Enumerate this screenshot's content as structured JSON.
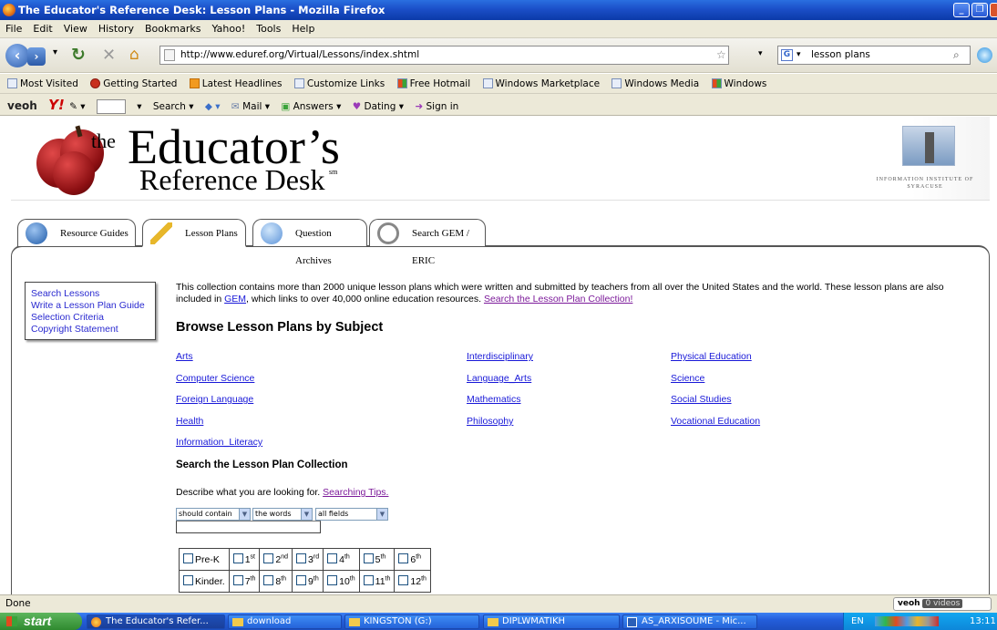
{
  "window": {
    "title": "The Educator's Reference Desk: Lesson Plans - Mozilla Firefox"
  },
  "menu": [
    "File",
    "Edit",
    "View",
    "History",
    "Bookmarks",
    "Yahoo!",
    "Tools",
    "Help"
  ],
  "nav": {
    "url": "http://www.eduref.org/Virtual/Lessons/index.shtml",
    "search_value": "lesson plans"
  },
  "bookmarks": [
    "Most Visited",
    "Getting Started",
    "Latest Headlines",
    "Customize Links",
    "Free Hotmail",
    "Windows Marketplace",
    "Windows Media",
    "Windows"
  ],
  "veoh_toolbar": {
    "logo": "veoh",
    "search": "Search",
    "mail": "Mail",
    "answers": "Answers",
    "dating": "Dating",
    "signin": "Sign in"
  },
  "header": {
    "the": "the",
    "title": "Educator’s",
    "subtitle": "Reference Desk",
    "sm": "sm",
    "institute": "INFORMATION INSTITUTE OF SYRACUSE"
  },
  "tabs": [
    "Resource Guides",
    "Lesson Plans",
    "Question Archives",
    "Search GEM / ERIC"
  ],
  "sidebar": [
    "Search Lessons",
    "Write a Lesson Plan Guide",
    "Selection Criteria",
    "Copyright Statement"
  ],
  "intro": {
    "text1": "This collection contains more than 2000 unique lesson plans which were written and submitted by teachers from all over the United States and the world. These lesson plans are also included in ",
    "gem": "GEM",
    "text2": ", which links to over 40,000 online education resources. ",
    "search_link": "Search the Lesson Plan Collection!"
  },
  "browse": {
    "heading": "Browse Lesson Plans by Subject",
    "col1": [
      "Arts",
      "Computer Science",
      "Foreign Language",
      "Health",
      "Information_Literacy"
    ],
    "col2": [
      "Interdisciplinary",
      "Language_Arts",
      "Mathematics",
      "Philosophy"
    ],
    "col3": [
      "Physical Education",
      "Science",
      "Social Studies",
      "Vocational Education"
    ]
  },
  "search": {
    "heading": "Search the Lesson Plan Collection",
    "describe": "Describe what you are looking for. ",
    "tips": "Searching Tips.",
    "sel1": "should contain",
    "sel2": "the words",
    "sel3": "all fields"
  },
  "grades": {
    "row1": [
      {
        "b": "Pre-K",
        "s": ""
      },
      {
        "b": "1",
        "s": "st"
      },
      {
        "b": "2",
        "s": "nd"
      },
      {
        "b": "3",
        "s": "rd"
      },
      {
        "b": "4",
        "s": "th"
      },
      {
        "b": "5",
        "s": "th"
      },
      {
        "b": "6",
        "s": "th"
      }
    ],
    "row2": [
      {
        "b": "Kinder.",
        "s": ""
      },
      {
        "b": "7",
        "s": "th"
      },
      {
        "b": "8",
        "s": "th"
      },
      {
        "b": "9",
        "s": "th"
      },
      {
        "b": "10",
        "s": "th"
      },
      {
        "b": "11",
        "s": "th"
      },
      {
        "b": "12",
        "s": "th"
      }
    ]
  },
  "status": {
    "text": "Done",
    "veoh": "veoh",
    "videos": "0 videos"
  },
  "taskbar": {
    "start": "start",
    "tasks": [
      "The Educator's Refer...",
      "download",
      "KINGSTON (G:)",
      "DIPLWMATIKH",
      "AS_ARXISOUME - Mic..."
    ],
    "lang": "EN",
    "clock": "13:11"
  }
}
